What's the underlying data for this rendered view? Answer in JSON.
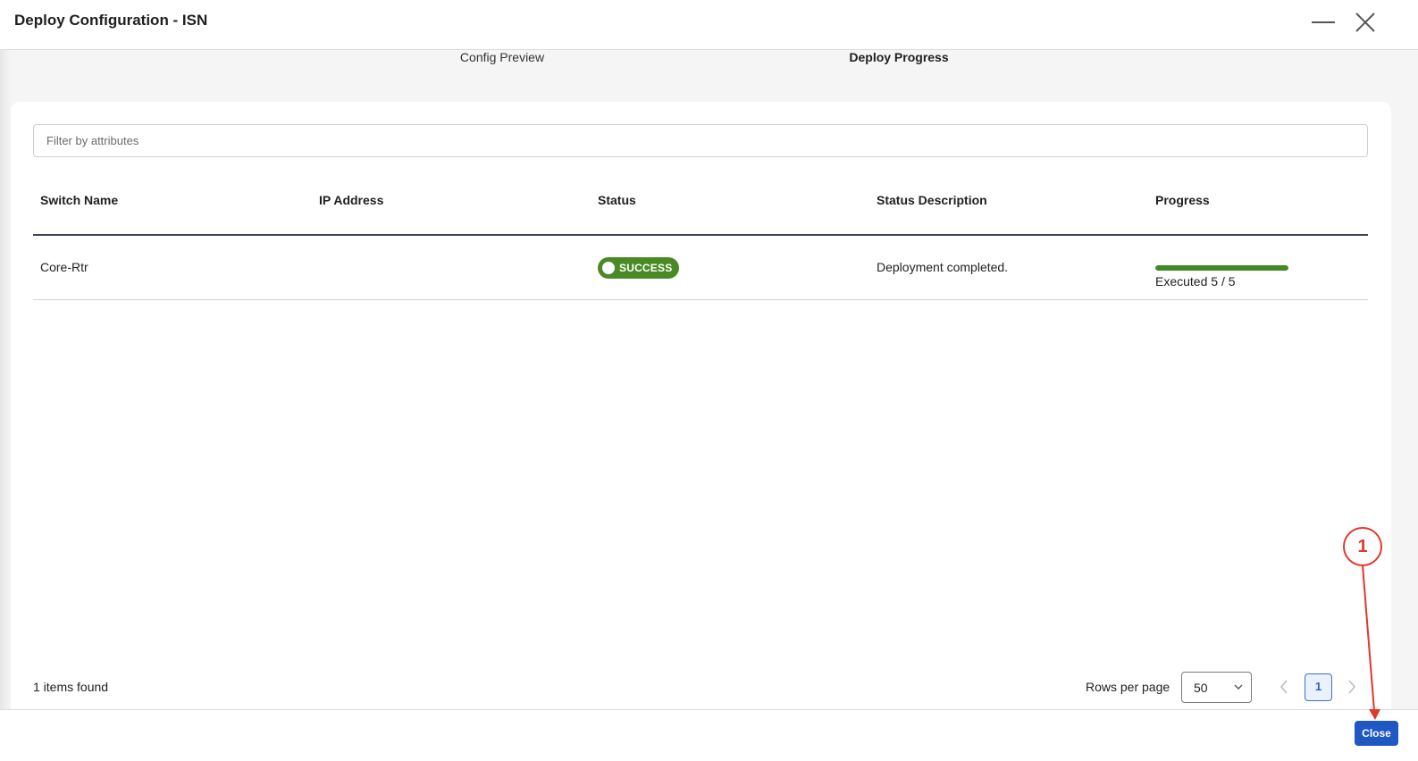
{
  "window": {
    "title": "Deploy Configuration - ISN",
    "minimize_icon": "minimize-icon",
    "close_icon": "close-icon"
  },
  "steps": [
    {
      "label": "Config Preview",
      "active": false
    },
    {
      "label": "Deploy Progress",
      "active": true
    }
  ],
  "filter": {
    "placeholder": "Filter by attributes",
    "value": ""
  },
  "table": {
    "columns": [
      "Switch Name",
      "IP Address",
      "Status",
      "Status Description",
      "Progress"
    ],
    "rows": [
      {
        "switch_name": "Core-Rtr",
        "ip_address": "",
        "status": "SUCCESS",
        "status_description": "Deployment completed.",
        "progress": {
          "fraction": 1.0,
          "label": "Executed 5 / 5"
        }
      }
    ]
  },
  "footer": {
    "items_found": "1 items found",
    "rows_per_page_label": "Rows per page",
    "rows_per_page_value": "50",
    "current_page": "1"
  },
  "actions": {
    "close_label": "Close"
  },
  "annotation": {
    "number": "1",
    "color": "#e0392b"
  },
  "colors": {
    "success": "#4a8a25",
    "progress": "#3f8a24",
    "primary": "#1f57c3"
  }
}
